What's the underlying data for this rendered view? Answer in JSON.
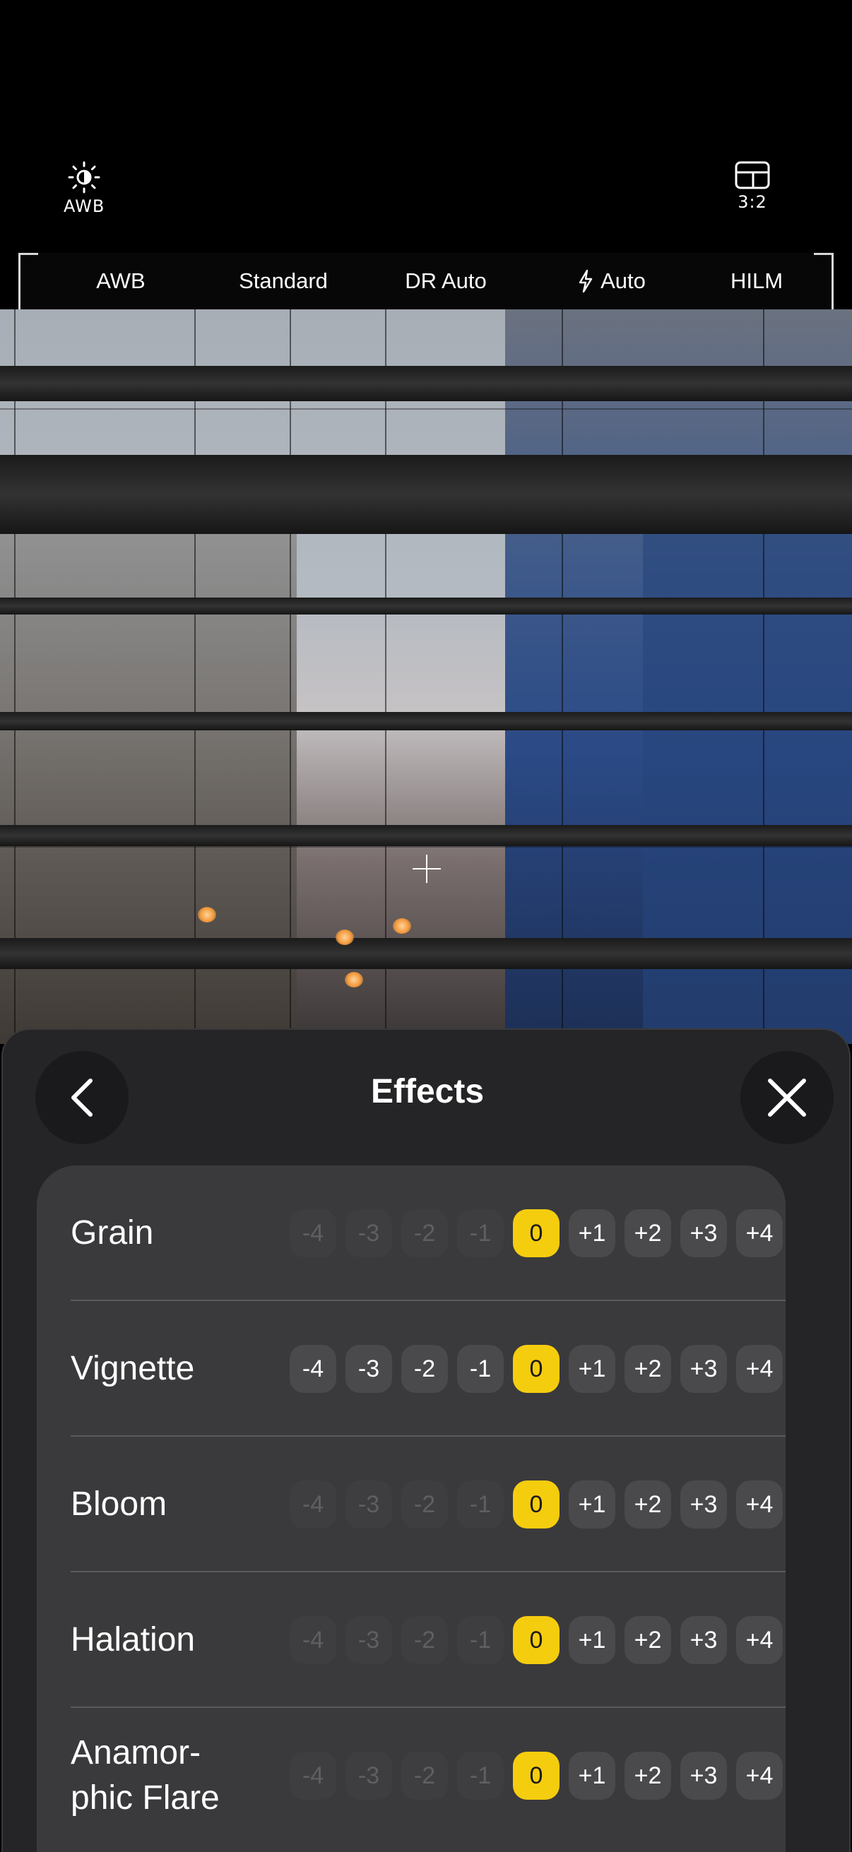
{
  "top": {
    "awb_label": "AWB",
    "ratio_label": "3:2"
  },
  "strip": {
    "items": [
      "AWB",
      "Standard",
      "DR Auto",
      "Auto",
      "HILM"
    ]
  },
  "panel": {
    "title": "Effects",
    "rows": [
      {
        "name": "Grain",
        "values": [
          "-4",
          "-3",
          "-2",
          "-1",
          "0",
          "+1",
          "+2",
          "+3",
          "+4"
        ],
        "selected": "0",
        "negatives_enabled": false
      },
      {
        "name": "Vignette",
        "values": [
          "-4",
          "-3",
          "-2",
          "-1",
          "0",
          "+1",
          "+2",
          "+3",
          "+4"
        ],
        "selected": "0",
        "negatives_enabled": true
      },
      {
        "name": "Bloom",
        "values": [
          "-4",
          "-3",
          "-2",
          "-1",
          "0",
          "+1",
          "+2",
          "+3",
          "+4"
        ],
        "selected": "0",
        "negatives_enabled": false
      },
      {
        "name": "Halation",
        "values": [
          "-4",
          "-3",
          "-2",
          "-1",
          "0",
          "+1",
          "+2",
          "+3",
          "+4"
        ],
        "selected": "0",
        "negatives_enabled": false
      },
      {
        "name": "Anamor-\nphic Flare",
        "values": [
          "-4",
          "-3",
          "-2",
          "-1",
          "0",
          "+1",
          "+2",
          "+3",
          "+4"
        ],
        "selected": "0",
        "negatives_enabled": false
      }
    ]
  },
  "icons": {
    "exposure": "brightness-icon",
    "ratio": "aspect-ratio-icon",
    "flash": "flash-icon",
    "back": "chevron-left-icon",
    "close": "close-icon"
  },
  "colors": {
    "accent": "#f5cd0f",
    "panel": "#252527",
    "card": "#3a3a3c"
  }
}
